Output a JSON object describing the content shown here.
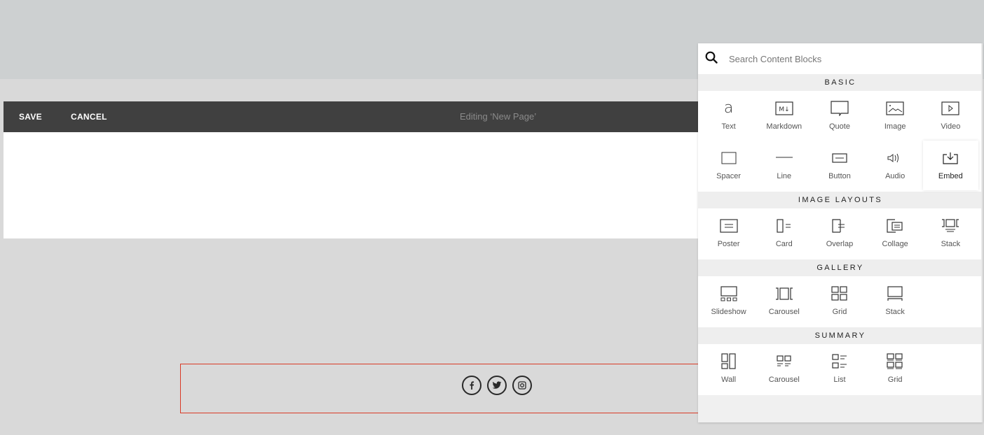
{
  "toolbar": {
    "save_label": "SAVE",
    "cancel_label": "CANCEL",
    "title": "Editing ‘New Page’"
  },
  "footer": {
    "social": [
      {
        "name": "facebook-icon",
        "glyph": "f"
      },
      {
        "name": "twitter-icon",
        "glyph": "twitter"
      },
      {
        "name": "instagram-icon",
        "glyph": "instagram"
      }
    ]
  },
  "panel": {
    "search_placeholder": "Search Content Blocks",
    "sections": [
      {
        "title": "BASIC",
        "rows": [
          [
            {
              "label": "Text",
              "icon": "text-icon"
            },
            {
              "label": "Markdown",
              "icon": "markdown-icon"
            },
            {
              "label": "Quote",
              "icon": "quote-icon"
            },
            {
              "label": "Image",
              "icon": "image-icon"
            },
            {
              "label": "Video",
              "icon": "video-icon"
            }
          ],
          [
            {
              "label": "Spacer",
              "icon": "spacer-icon"
            },
            {
              "label": "Line",
              "icon": "line-icon"
            },
            {
              "label": "Button",
              "icon": "button-icon"
            },
            {
              "label": "Audio",
              "icon": "audio-icon"
            },
            {
              "label": "Embed",
              "icon": "embed-icon",
              "highlighted": true
            }
          ]
        ]
      },
      {
        "title": "IMAGE LAYOUTS",
        "rows": [
          [
            {
              "label": "Poster",
              "icon": "poster-icon"
            },
            {
              "label": "Card",
              "icon": "card-icon"
            },
            {
              "label": "Overlap",
              "icon": "overlap-icon"
            },
            {
              "label": "Collage",
              "icon": "collage-icon"
            },
            {
              "label": "Stack",
              "icon": "stack-layout-icon"
            }
          ]
        ]
      },
      {
        "title": "GALLERY",
        "rows": [
          [
            {
              "label": "Slideshow",
              "icon": "slideshow-icon"
            },
            {
              "label": "Carousel",
              "icon": "gallery-carousel-icon"
            },
            {
              "label": "Grid",
              "icon": "gallery-grid-icon"
            },
            {
              "label": "Stack",
              "icon": "gallery-stack-icon"
            }
          ]
        ]
      },
      {
        "title": "SUMMARY",
        "rows": [
          [
            {
              "label": "Wall",
              "icon": "wall-icon"
            },
            {
              "label": "Carousel",
              "icon": "summary-carousel-icon"
            },
            {
              "label": "List",
              "icon": "list-icon"
            },
            {
              "label": "Grid",
              "icon": "summary-grid-icon"
            }
          ]
        ]
      }
    ]
  }
}
